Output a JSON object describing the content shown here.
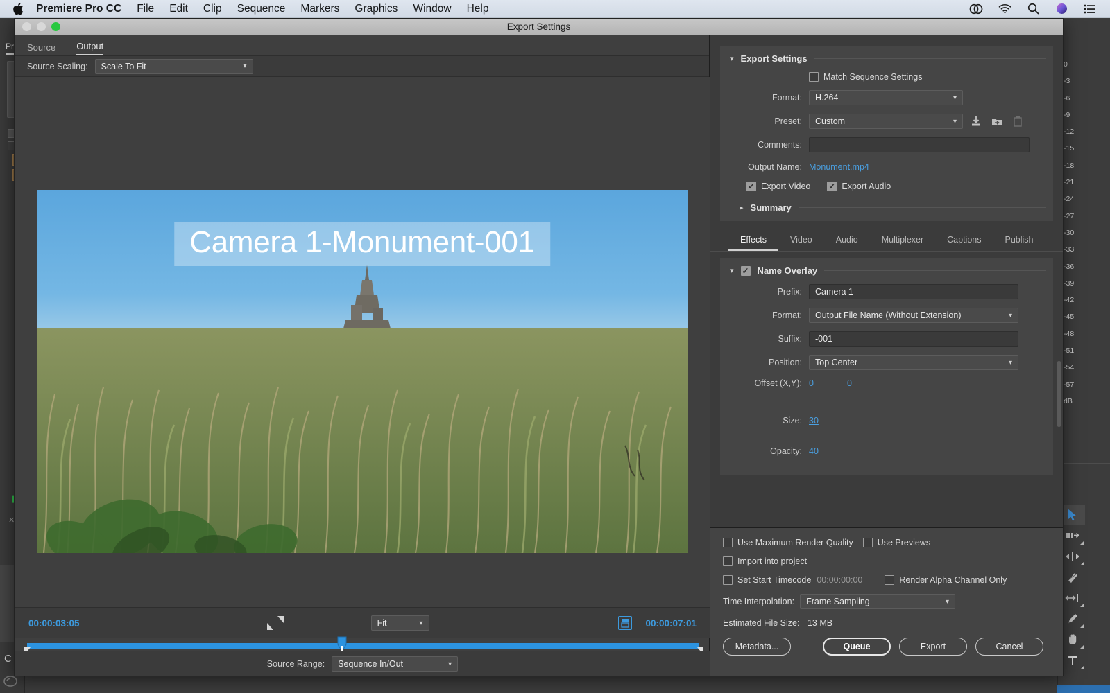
{
  "menubar": {
    "apple_icon": "apple-logo-icon",
    "app_name": "Premiere Pro CC",
    "items": [
      "File",
      "Edit",
      "Clip",
      "Sequence",
      "Markers",
      "Graphics",
      "Window",
      "Help"
    ],
    "status_icons": [
      "creative-cloud-icon",
      "wifi-icon",
      "search-icon",
      "siri-icon",
      "control-center-icon"
    ]
  },
  "dialog": {
    "title": "Export Settings",
    "window_controls": [
      "close",
      "minimize",
      "maximize"
    ]
  },
  "preview": {
    "tabs": [
      {
        "label": "Source",
        "active": false
      },
      {
        "label": "Output",
        "active": true
      }
    ],
    "source_scaling": {
      "label": "Source Scaling:",
      "value": "Scale To Fit"
    },
    "overlay_text": "Camera 1-Monument-001",
    "transport": {
      "current_timecode": "00:00:03:05",
      "duration_timecode": "00:00:07:01",
      "zoom_level": "Fit",
      "mark_in_icon": "mark-in-icon",
      "mark_out_icon": "mark-out-icon",
      "export_frame_icon": "export-frame-icon"
    },
    "source_range": {
      "label": "Source Range:",
      "value": "Sequence In/Out"
    }
  },
  "export_settings": {
    "section_title": "Export Settings",
    "match_sequence_settings": {
      "label": "Match Sequence Settings",
      "checked": false
    },
    "format": {
      "label": "Format:",
      "value": "H.264"
    },
    "preset": {
      "label": "Preset:",
      "value": "Custom",
      "icons": [
        "save-preset-icon",
        "import-preset-icon",
        "delete-preset-icon"
      ]
    },
    "comments": {
      "label": "Comments:",
      "value": "",
      "placeholder": ""
    },
    "output_name": {
      "label": "Output Name:",
      "value": "Monument.mp4"
    },
    "export_video": {
      "label": "Export Video",
      "checked": true
    },
    "export_audio": {
      "label": "Export Audio",
      "checked": true
    },
    "summary": {
      "label": "Summary"
    }
  },
  "effect_tabs": [
    {
      "label": "Effects",
      "active": true
    },
    {
      "label": "Video",
      "active": false
    },
    {
      "label": "Audio",
      "active": false
    },
    {
      "label": "Multiplexer",
      "active": false
    },
    {
      "label": "Captions",
      "active": false
    },
    {
      "label": "Publish",
      "active": false
    }
  ],
  "name_overlay": {
    "section_title": "Name Overlay",
    "enabled": true,
    "prefix": {
      "label": "Prefix:",
      "value": "Camera 1-"
    },
    "format": {
      "label": "Format:",
      "value": "Output File Name (Without Extension)"
    },
    "suffix": {
      "label": "Suffix:",
      "value": "-001"
    },
    "position": {
      "label": "Position:",
      "value": "Top Center"
    },
    "offset": {
      "label": "Offset (X,Y):",
      "x": "0",
      "y": "0"
    },
    "size": {
      "label": "Size:",
      "value": "30"
    },
    "opacity": {
      "label": "Opacity:",
      "value": "40"
    }
  },
  "render_options": {
    "use_maximum_render_quality": {
      "label": "Use Maximum Render Quality",
      "checked": false
    },
    "use_previews": {
      "label": "Use Previews",
      "checked": false
    },
    "import_into_project": {
      "label": "Import into project",
      "checked": false
    },
    "set_start_timecode": {
      "label": "Set Start Timecode",
      "checked": false,
      "value": "00:00:00:00"
    },
    "render_alpha_channel_only": {
      "label": "Render Alpha Channel Only",
      "checked": false
    },
    "time_interpolation": {
      "label": "Time Interpolation:",
      "value": "Frame Sampling"
    },
    "estimated_file_size": {
      "label": "Estimated File Size:",
      "value": "13 MB"
    }
  },
  "buttons": {
    "metadata": "Metadata...",
    "queue": "Queue",
    "export": "Export",
    "cancel": "Cancel"
  },
  "audio_meter": {
    "ticks": [
      "0",
      "-3",
      "-6",
      "-9",
      "-12",
      "-15",
      "-18",
      "-21",
      "-24",
      "-27",
      "-30",
      "-33",
      "-36",
      "-39",
      "-42",
      "-45",
      "-48",
      "-51",
      "-54",
      "-57",
      "dB"
    ]
  },
  "tools": [
    {
      "name": "selection-tool-icon",
      "active": true
    },
    {
      "name": "track-select-forward-tool-icon",
      "active": false
    },
    {
      "name": "ripple-edit-tool-icon",
      "active": false
    },
    {
      "name": "razor-tool-icon",
      "active": false
    },
    {
      "name": "slip-tool-icon",
      "active": false
    },
    {
      "name": "pen-tool-icon",
      "active": false
    },
    {
      "name": "hand-tool-icon",
      "active": false
    },
    {
      "name": "type-tool-icon",
      "active": false
    }
  ],
  "background_panel": {
    "project_tab": "Pr",
    "timeline_label": "C"
  },
  "colors": {
    "accent_blue": "#3c9ade",
    "link_blue": "#4a9fe0",
    "panel_bg": "#3b3b3b",
    "card_bg": "#454545",
    "macos_green": "#28c840"
  }
}
